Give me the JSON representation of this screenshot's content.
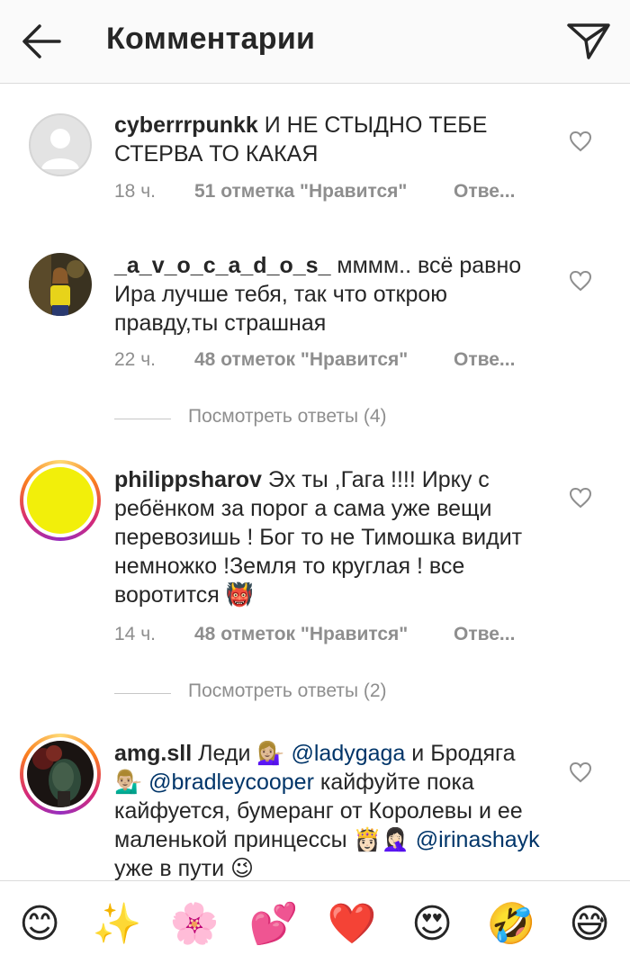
{
  "header": {
    "title": "Комментарии"
  },
  "comments": [
    {
      "username": "cyberrrpunkk",
      "text": "И НЕ СТЫДНО ТЕБЕ СТЕРВА ТО КАКАЯ",
      "time": "18 ч.",
      "likes": "51 отметка \"Нравится\"",
      "reply": "Отве..."
    },
    {
      "username": "_a_v_o_c_a_d_o_s_",
      "text": "мммм.. всё равно Ира лучше тебя, так что открою правду,ты страшная",
      "time": "22 ч.",
      "likes": "48 отметок \"Нравится\"",
      "reply": "Отве...",
      "view_replies": "Посмотреть ответы (4)"
    },
    {
      "username": "philippsharov",
      "text": "Эх ты ,Гага !!!! Ирку с ребёнком за порог а сама уже вещи перевозишь ! Бог то не Тимошка видит немножко !Земля то круглая ! все воротится",
      "emoji": "👹",
      "time": "14 ч.",
      "likes": "48 отметок \"Нравится\"",
      "reply": "Отве...",
      "view_replies": "Посмотреть ответы (2)"
    },
    {
      "username": "amg.sll",
      "t1": "Леди",
      "e1": "💁🏼‍♀️",
      "m1": "@ladygaga",
      "t2": "и Бродяга",
      "e2": "💁🏼‍♂️",
      "m2": "@bradleycooper",
      "t3": "кайфуйте пока кайфуется, бумеранг от Королевы и ее маленькой принцессы",
      "e3": "👸🏻🤦🏻‍♀️",
      "m3": "@irinashayk",
      "t4": "уже в пути",
      "e4": "😉"
    }
  ],
  "emoji_bar": [
    "😊",
    "✨",
    "🌸",
    "💕",
    "❤️",
    "😍",
    "🤣",
    "😅"
  ],
  "icons": {
    "back": "arrow-left-icon",
    "share": "paper-plane-icon",
    "like": "heart-outline-icon"
  }
}
